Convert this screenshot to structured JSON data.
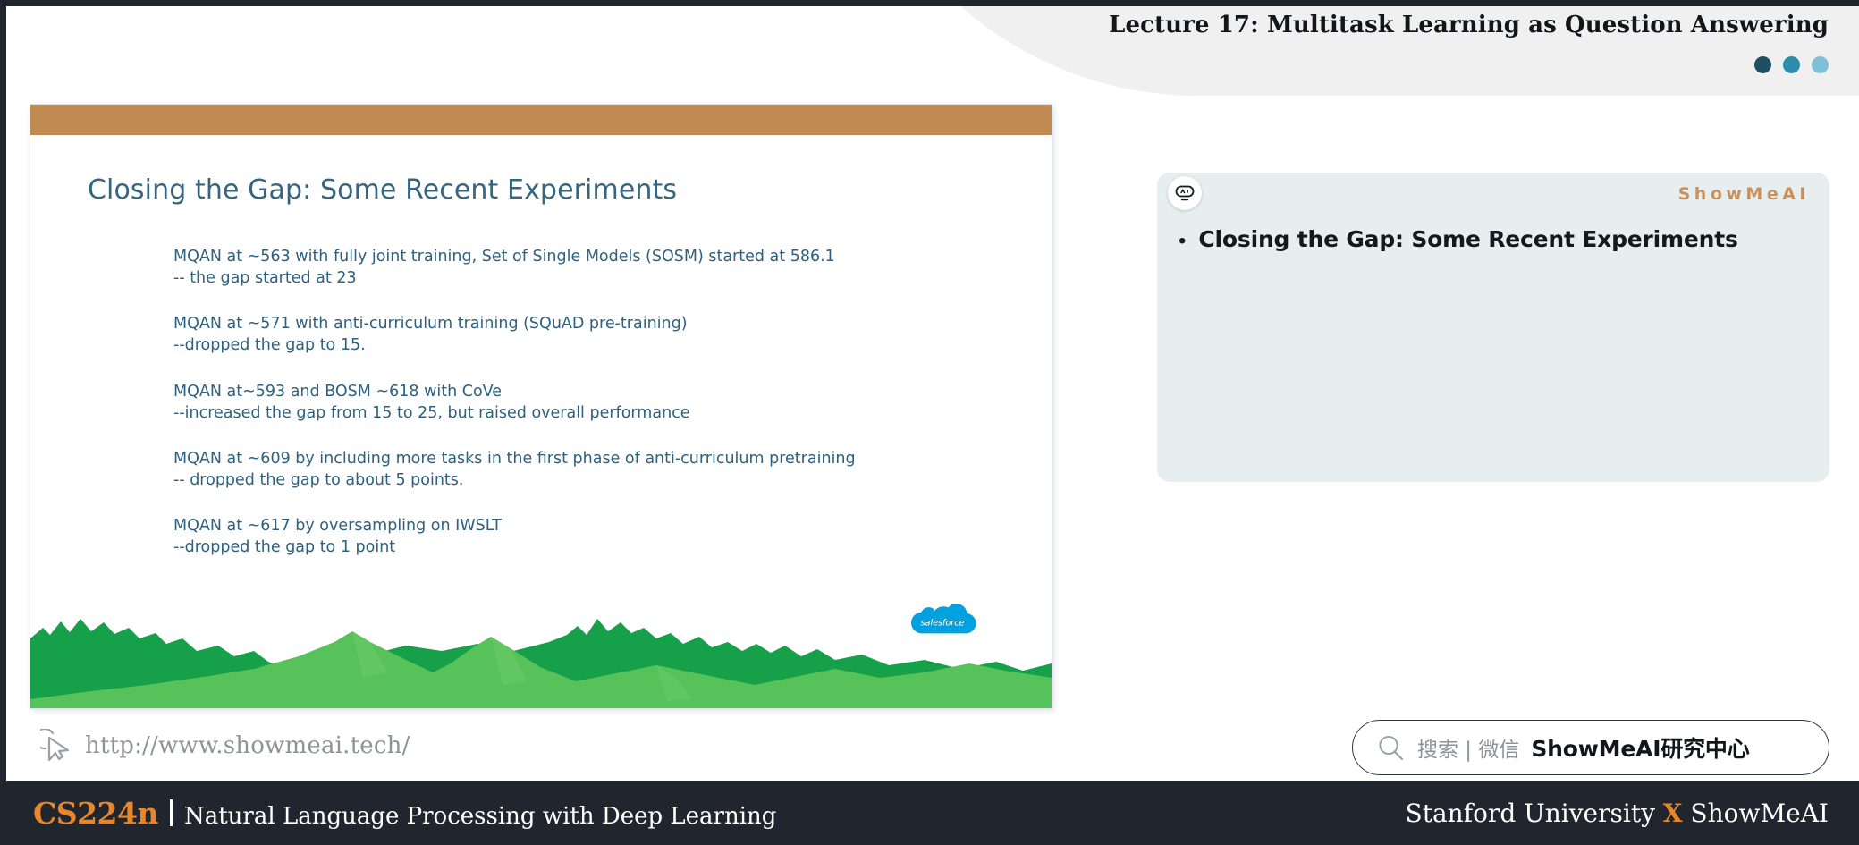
{
  "header": {
    "title": "Lecture 17: Multitask Learning as Question Answering",
    "dots": [
      {
        "name": "progress-dot-1",
        "color": "#1f4f63"
      },
      {
        "name": "progress-dot-2",
        "color": "#2b8cab"
      },
      {
        "name": "progress-dot-3",
        "color": "#7ec0d6"
      }
    ]
  },
  "slide": {
    "accent_bar_color": "#c08a52",
    "heading": "Closing the Gap: Some Recent Experiments",
    "heading_color": "#36667f",
    "body_color": "#2e6180",
    "paragraphs": [
      {
        "line1": "MQAN at ~563 with fully joint training, Set of Single Models (SOSM) started at 586.1",
        "line2": "-- the gap started at 23"
      },
      {
        "line1": "MQAN at ~571 with anti-curriculum training (SQuAD pre-training)",
        "line2": "--dropped the gap to 15."
      },
      {
        "line1": "MQAN at~593 and BOSM ~618 with CoVe",
        "line2": "--increased the gap from 15 to 25, but raised overall performance"
      },
      {
        "line1": "MQAN at ~609 by including more tasks in the first phase of anti-curriculum pretraining",
        "line2": "-- dropped the gap to about 5 points."
      },
      {
        "line1": "MQAN at ~617 by oversampling on IWSLT",
        "line2": " --dropped the gap to 1 point"
      }
    ],
    "logo_label": "salesforce",
    "logo_color": "#00a1e0",
    "mountain_back_color": "#17a04a",
    "mountain_front_color": "#57c25a"
  },
  "url_bar": {
    "url": "http://www.showmeai.tech/",
    "cursor_icon": "cursor-arrow-icon"
  },
  "note_panel": {
    "background": "#e7eef0",
    "badge_icon": "robot-face-icon",
    "brand": "ShowMeAI",
    "brand_color": "#c8925f",
    "bullet_marker": "•",
    "bullet_text": "Closing the Gap: Some Recent Experiments"
  },
  "search": {
    "icon": "search-icon",
    "hint": "搜索 | 微信",
    "brand": "ShowMeAI研究中心"
  },
  "footer": {
    "course_code": "CS224n",
    "course_code_color": "#e8872a",
    "course_name": "Natural Language Processing with Deep Learning",
    "right_prefix": "Stanford University ",
    "right_x": "X",
    "right_suffix": " ShowMeAI",
    "background": "#21262e"
  }
}
